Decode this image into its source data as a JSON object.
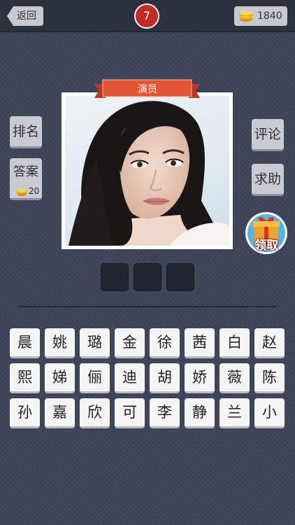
{
  "topbar": {
    "back_label": "返回",
    "level": "7",
    "coins": "1840"
  },
  "side_left": {
    "rank_label": "排名",
    "answer_label": "答案",
    "answer_cost": "20"
  },
  "side_right": {
    "comment_label": "评论",
    "help_label": "求助"
  },
  "category": "演员",
  "gift_label": "领取",
  "answer_slots": [
    "",
    "",
    ""
  ],
  "keyboard": {
    "row1": [
      "晨",
      "姚",
      "璐",
      "金",
      "徐",
      "茜",
      "白",
      "赵"
    ],
    "row2": [
      "熙",
      "娣",
      "俪",
      "迪",
      "胡",
      "娇",
      "薇",
      "陈"
    ],
    "row3": [
      "孙",
      "嘉",
      "欣",
      "可",
      "李",
      "静",
      "兰",
      "小"
    ]
  },
  "colors": {
    "accent_red": "#c22a25",
    "ribbon": "#e35535",
    "coin": "#f2b01e"
  }
}
